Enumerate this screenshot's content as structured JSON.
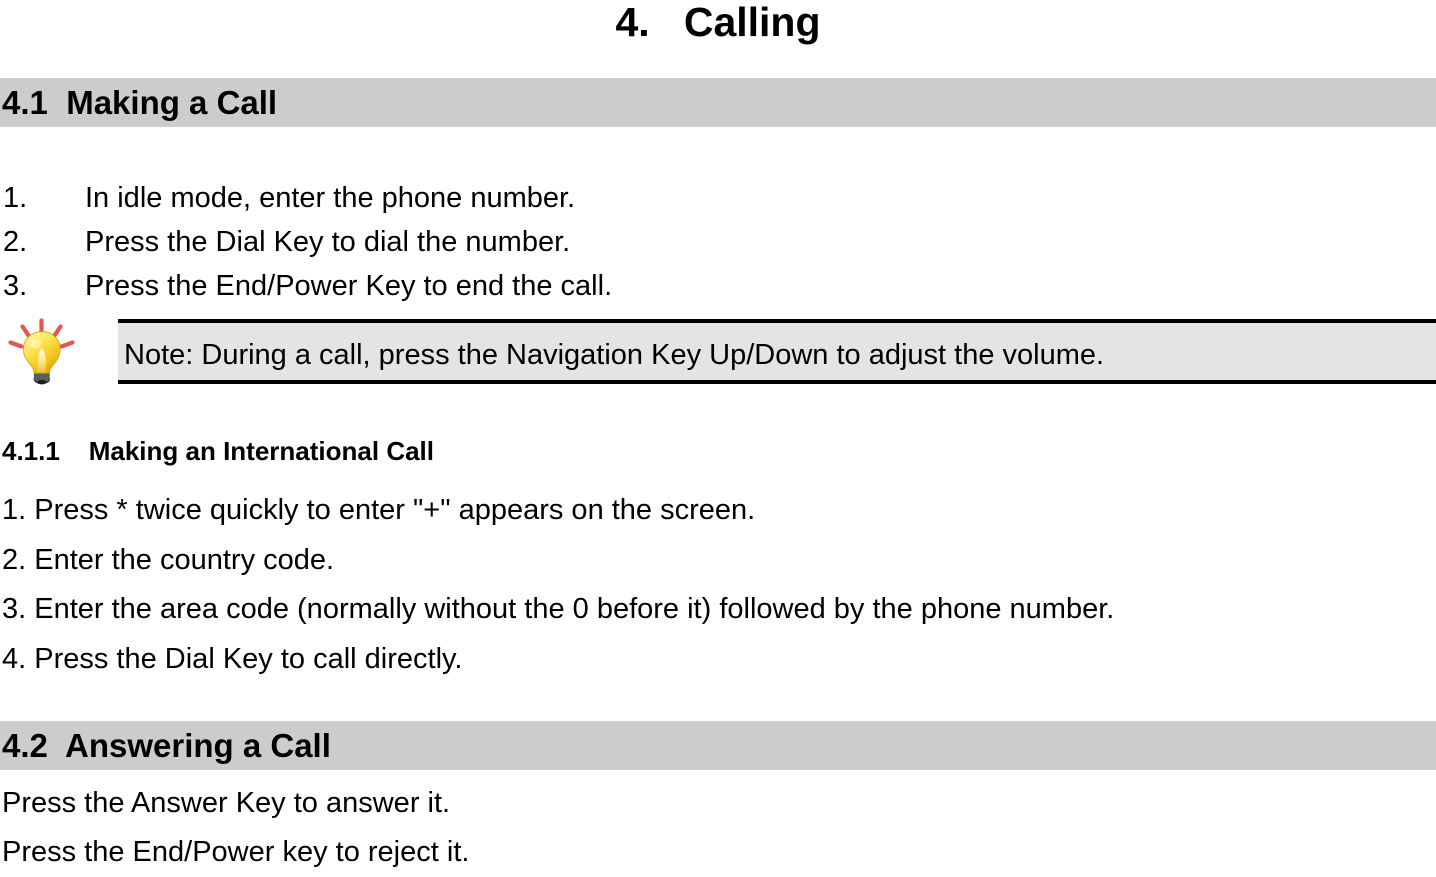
{
  "document": {
    "chapter_title": "4.   Calling",
    "section_bar_color": "#cccccc",
    "note_box_color": "#e4e4e4",
    "text_color": "#000000"
  },
  "section_making_a_call": {
    "heading": "4.1  Making a Call",
    "steps": [
      {
        "num": "1.",
        "text": "In idle mode, enter the phone number."
      },
      {
        "num": "2.",
        "text": "Press the Dial Key to dial the number."
      },
      {
        "num": "3.",
        "text": "Press the End/Power Key to end the call."
      }
    ],
    "note": {
      "icon": "lightbulb-icon",
      "text": "Note: During a call, press the Navigation Key Up/Down to adjust the volume."
    },
    "subsection": {
      "heading": "4.1.1    Making an International Call",
      "lines": [
        "1. Press * twice quickly to enter \"+\" appears on the screen.",
        "2. Enter the country code.",
        "3. Enter the area code (normally without the 0 before it) followed by the phone number.",
        "4. Press the Dial Key to call directly."
      ]
    }
  },
  "section_answering_a_call": {
    "heading": "4.2  Answering a Call",
    "lines": [
      "Press the Answer Key to answer it.",
      "Press the End/Power key to reject it."
    ]
  }
}
